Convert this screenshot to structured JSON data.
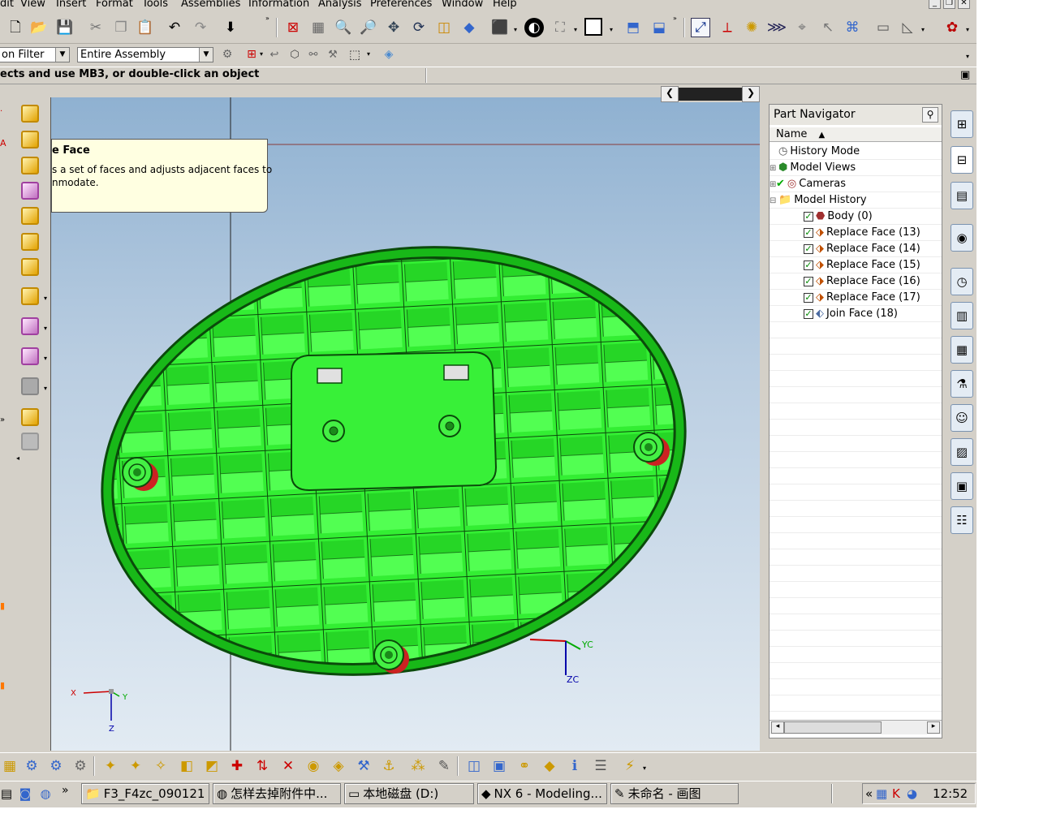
{
  "menu": [
    "dit",
    "View",
    "Insert",
    "Format",
    "Tools",
    "Assemblies",
    "Information",
    "Analysis",
    "Preferences",
    "Window",
    "Help"
  ],
  "toolbar2": {
    "selection_filter": "on Filter",
    "scope": "Entire Assembly"
  },
  "cue_line": "ects and use MB3, or double-click an object",
  "tooltip": {
    "title": "e Face",
    "body_line1": "s a set of faces and adjusts adjacent faces to",
    "body_line2": "nmodate."
  },
  "viewport": {
    "wcs_labels": {
      "yc": "YC",
      "zc": "ZC"
    },
    "abs_labels": {
      "x": "X",
      "y": "Y",
      "z": "Z"
    },
    "body_color": "#22dd22",
    "edge_color": "#0b4a0b",
    "boss_color": "#cc2222"
  },
  "navigator": {
    "title": "Part Navigator",
    "column_name": "Name",
    "items": [
      {
        "label": "History Mode",
        "icon": "clock-icon",
        "level": 0,
        "expander": "",
        "checked": false
      },
      {
        "label": "Model Views",
        "icon": "views-icon",
        "level": 0,
        "expander": "+",
        "checked": false
      },
      {
        "label": "Cameras",
        "icon": "camera-icon",
        "level": 0,
        "expander": "+",
        "checked": true
      },
      {
        "label": "Model History",
        "icon": "folder-icon",
        "level": 0,
        "expander": "-",
        "checked": false
      },
      {
        "label": "Body (0)",
        "icon": "body-icon",
        "level": 1,
        "expander": "",
        "checked": true
      },
      {
        "label": "Replace Face (13)",
        "icon": "replace-face-icon",
        "level": 1,
        "expander": "",
        "checked": true
      },
      {
        "label": "Replace Face (14)",
        "icon": "replace-face-icon",
        "level": 1,
        "expander": "",
        "checked": true
      },
      {
        "label": "Replace Face (15)",
        "icon": "replace-face-icon",
        "level": 1,
        "expander": "",
        "checked": true
      },
      {
        "label": "Replace Face (16)",
        "icon": "replace-face-icon",
        "level": 1,
        "expander": "",
        "checked": true
      },
      {
        "label": "Replace Face (17)",
        "icon": "replace-face-icon",
        "level": 1,
        "expander": "",
        "checked": true
      },
      {
        "label": "Join Face (18)",
        "icon": "join-face-icon",
        "level": 1,
        "expander": "",
        "checked": true
      }
    ]
  },
  "taskbar": {
    "tasks": [
      {
        "label": "F3_F4zc_090121",
        "icon": "folder-icon"
      },
      {
        "label": "怎样去掉附件中...",
        "icon": "browser-icon"
      },
      {
        "label": "本地磁盘 (D:)",
        "icon": "drive-icon"
      },
      {
        "label": "NX 6 - Modeling...",
        "icon": "nx-icon"
      },
      {
        "label": "未命名 - 画图",
        "icon": "paint-icon"
      }
    ],
    "clock": "12:52"
  }
}
